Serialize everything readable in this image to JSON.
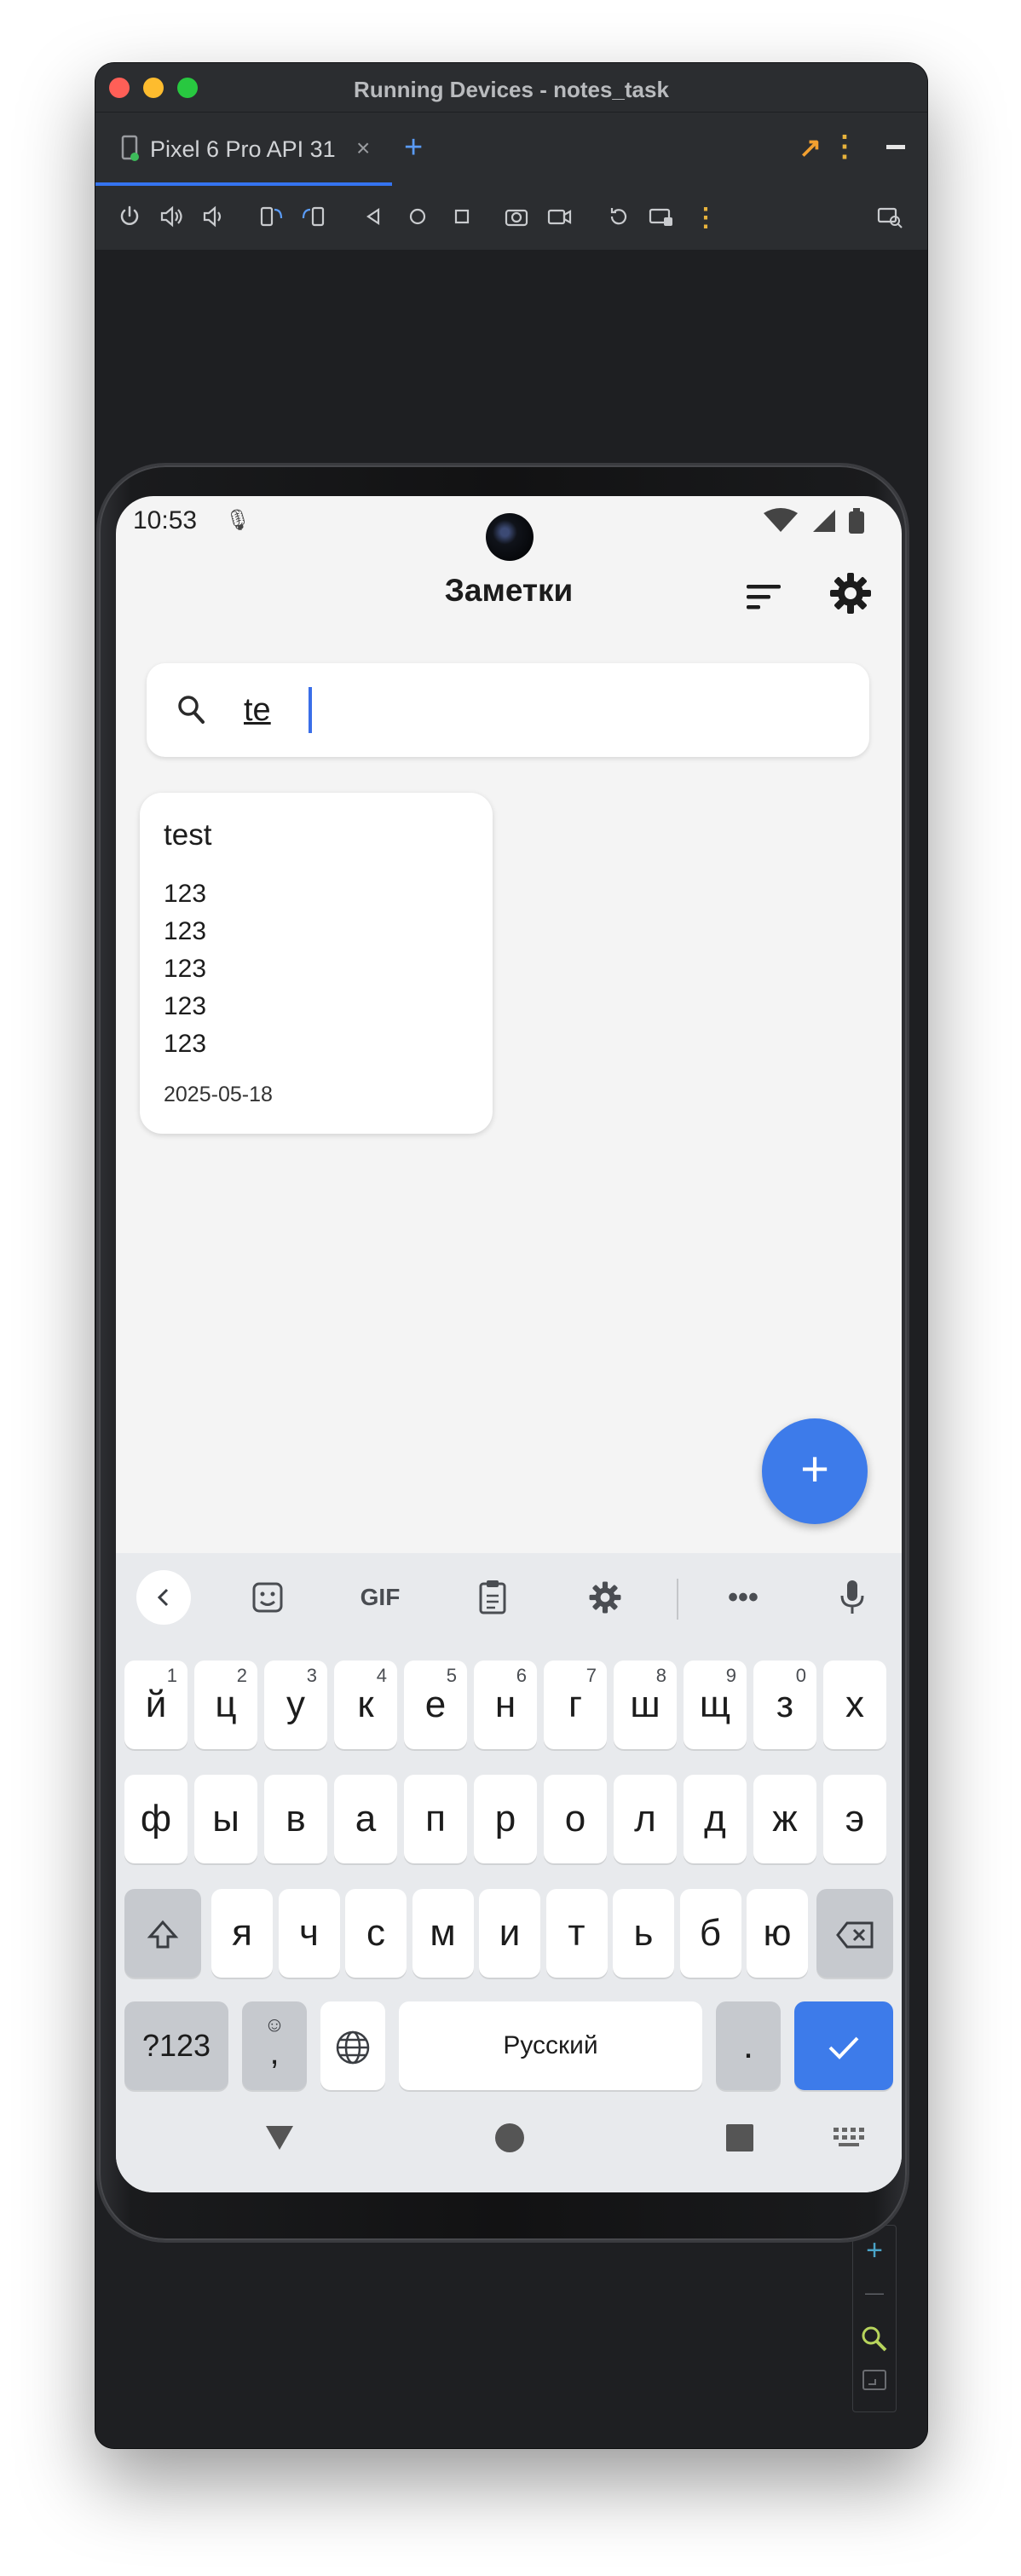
{
  "window": {
    "title": "Running Devices - notes_task"
  },
  "tabs": [
    {
      "label": "Pixel 6 Pro API 31",
      "close_glyph": "×"
    }
  ],
  "tab_add_glyph": "+",
  "toolbar_icons": [
    "power-icon",
    "volume-up-icon",
    "volume-down-icon",
    "rotate-left-icon",
    "rotate-right-icon",
    "back-icon",
    "home-icon",
    "overview-icon",
    "screenshot-icon",
    "screen-record-icon",
    "reset-icon",
    "keyboard-input-icon",
    "more-icon",
    "device-mirroring-icon"
  ],
  "zoom": {
    "plus": "+",
    "minus": "—"
  },
  "status_bar": {
    "time": "10:53"
  },
  "app": {
    "title": "Заметки",
    "search": {
      "value": "te"
    },
    "notes": [
      {
        "title": "test",
        "lines": [
          "123",
          "123",
          "123",
          "123",
          "123"
        ],
        "date": "2025-05-18"
      }
    ],
    "fab_glyph": "+"
  },
  "keyboard": {
    "toolbar": {
      "gif": "GIF"
    },
    "row1": [
      {
        "k": "й",
        "n": "1"
      },
      {
        "k": "ц",
        "n": "2"
      },
      {
        "k": "у",
        "n": "3"
      },
      {
        "k": "к",
        "n": "4"
      },
      {
        "k": "е",
        "n": "5"
      },
      {
        "k": "н",
        "n": "6"
      },
      {
        "k": "г",
        "n": "7"
      },
      {
        "k": "ш",
        "n": "8"
      },
      {
        "k": "щ",
        "n": "9"
      },
      {
        "k": "з",
        "n": "0"
      },
      {
        "k": "х",
        "n": ""
      }
    ],
    "row2": [
      "ф",
      "ы",
      "в",
      "а",
      "п",
      "р",
      "о",
      "л",
      "д",
      "ж",
      "э"
    ],
    "row3": [
      "я",
      "ч",
      "с",
      "м",
      "и",
      "т",
      "ь",
      "б",
      "ю"
    ],
    "symbols_label": "?123",
    "comma": ",",
    "space_label": "Русский",
    "period": "."
  },
  "colors": {
    "accent": "#3d7bea",
    "ide_tab_underline": "#3574f0"
  }
}
